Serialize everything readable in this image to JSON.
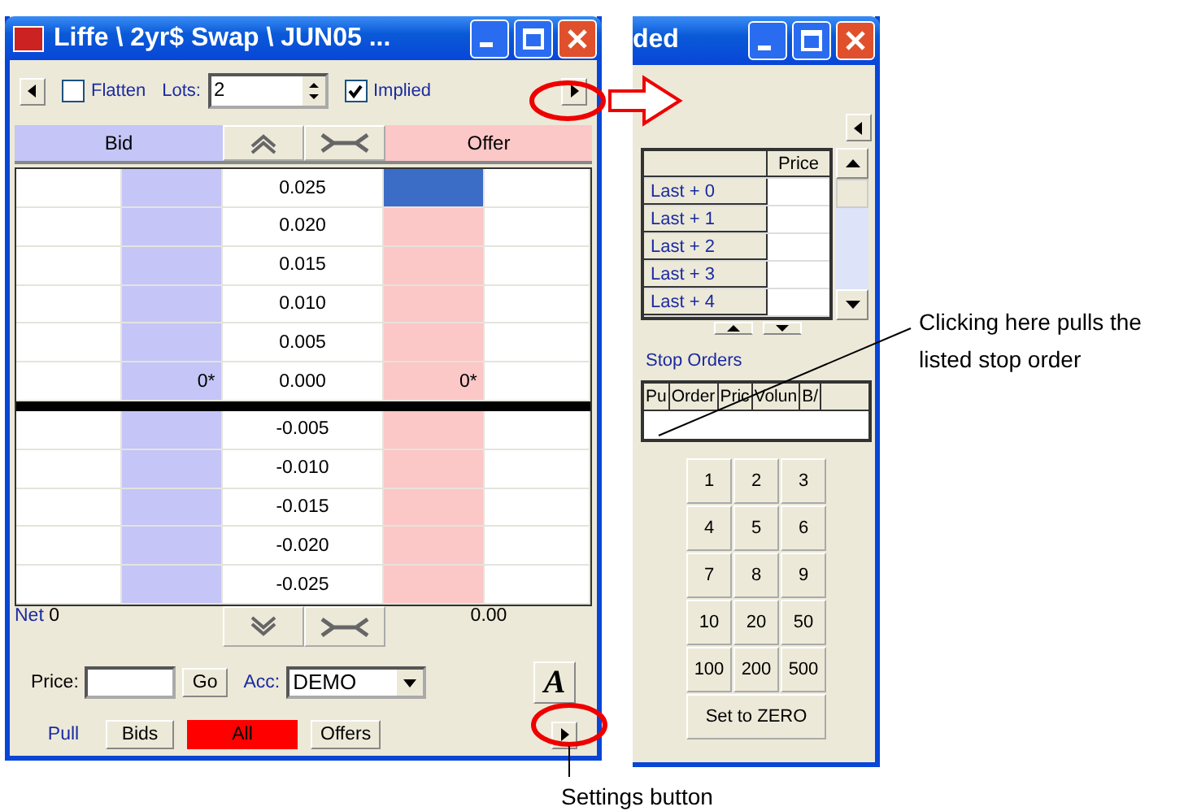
{
  "main_window": {
    "title": "Liffe \\ 2yr$ Swap \\ JUN05 ...",
    "toolbar": {
      "flatten": {
        "label": "Flatten",
        "checked": false
      },
      "lots_label": "Lots:",
      "lots_value": "2",
      "implied": {
        "label": "Implied",
        "checked": true
      }
    },
    "ladder": {
      "bid_header": "Bid",
      "offer_header": "Offer",
      "rows_above": [
        {
          "price": "0.025",
          "offer_selected": true
        },
        {
          "price": "0.020",
          "offer_selected": false
        },
        {
          "price": "0.015",
          "offer_selected": false
        },
        {
          "price": "0.010",
          "offer_selected": false
        },
        {
          "price": "0.005",
          "offer_selected": false
        },
        {
          "price": "0.000",
          "bid": "0*",
          "offer": "0*",
          "offer_selected": false
        }
      ],
      "rows_below": [
        {
          "price": "-0.005",
          "offer_selected": false
        },
        {
          "price": "-0.010",
          "offer_selected": false
        },
        {
          "price": "-0.015",
          "offer_selected": false
        },
        {
          "price": "-0.020",
          "offer_selected": false
        },
        {
          "price": "-0.025",
          "offer_selected": false
        }
      ]
    },
    "footer": {
      "net_label": "Net",
      "net_value": "0",
      "total": "0.00"
    },
    "order_bar": {
      "price_label": "Price:",
      "go": "Go",
      "account_label": "Acc:",
      "account_value": "DEMO",
      "font_button": "A"
    },
    "pull": {
      "label": "Pull",
      "buttons": [
        {
          "label": "Bids",
          "selected": false
        },
        {
          "label": "All",
          "selected": true
        },
        {
          "label": "Offers",
          "selected": false
        }
      ]
    }
  },
  "side_window": {
    "title": "ded",
    "price_table": {
      "header": "Price",
      "rows": [
        "Last + 0",
        "Last + 1",
        "Last + 2",
        "Last + 3",
        "Last + 4"
      ]
    },
    "stop_orders": {
      "title": "Stop Orders",
      "columns": [
        "Pu",
        "Order",
        "Pric",
        "Volun",
        "B/"
      ]
    },
    "keypad": [
      "1",
      "2",
      "3",
      "4",
      "5",
      "6",
      "7",
      "8",
      "9",
      "10",
      "20",
      "50",
      "100",
      "200",
      "500"
    ],
    "zero_button": "Set to ZERO"
  },
  "annotations": [
    {
      "text": "Clicking here pulls the listed stop order"
    },
    {
      "text": "Settings button"
    }
  ]
}
